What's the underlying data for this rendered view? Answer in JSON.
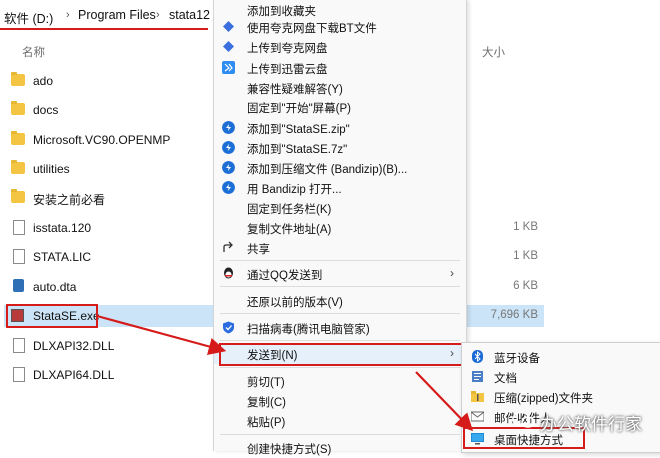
{
  "breadcrumb": {
    "drive": "软件 (D:)",
    "folder1": "Program Files",
    "folder2": "stata12",
    "separator": "›"
  },
  "columns": {
    "name": "名称",
    "size": "大小"
  },
  "files": [
    {
      "name": "ado",
      "size": "",
      "type": "folder"
    },
    {
      "name": "docs",
      "size": "",
      "type": "folder"
    },
    {
      "name": "Microsoft.VC90.OPENMP",
      "size": "",
      "type": "folder"
    },
    {
      "name": "utilities",
      "size": "",
      "type": "folder"
    },
    {
      "name": "安装之前必看",
      "size": "",
      "type": "folder"
    },
    {
      "name": "isstata.120",
      "size": "1 KB",
      "type": "file"
    },
    {
      "name": "STATA.LIC",
      "size": "1 KB",
      "type": "file"
    },
    {
      "name": "auto.dta",
      "size": "6 KB",
      "type": "dta"
    },
    {
      "name": "StataSE.exe",
      "size": "7,696 KB",
      "type": "exe"
    },
    {
      "name": "DLXAPI32.DLL",
      "size": "",
      "type": "file"
    },
    {
      "name": "DLXAPI64.DLL",
      "size": "",
      "type": "file"
    }
  ],
  "context_menu": {
    "items": [
      {
        "label": "添加到收藏夹",
        "icon": "none"
      },
      {
        "label": "使用夸克网盘下载BT文件",
        "icon": "quark-icon"
      },
      {
        "label": "上传到夸克网盘",
        "icon": "quark-icon"
      },
      {
        "label": "上传到迅雷云盘",
        "icon": "xunlei-icon"
      },
      {
        "label": "兼容性疑难解答(Y)",
        "icon": "none"
      },
      {
        "label": "固定到\"开始\"屏幕(P)",
        "icon": "none"
      },
      {
        "label": "添加到\"StataSE.zip\"",
        "icon": "bandizip-icon"
      },
      {
        "label": "添加到\"StataSE.7z\"",
        "icon": "bandizip-icon"
      },
      {
        "label": "添加到压缩文件 (Bandizip)(B)...",
        "icon": "bandizip-icon"
      },
      {
        "label": "用 Bandizip 打开...",
        "icon": "bandizip-icon"
      },
      {
        "label": "固定到任务栏(K)",
        "icon": "none"
      },
      {
        "label": "复制文件地址(A)",
        "icon": "none"
      },
      {
        "label": "共享",
        "icon": "share-icon"
      },
      {
        "label": "通过QQ发送到",
        "icon": "qq-icon"
      },
      {
        "label": "还原以前的版本(V)",
        "icon": "none"
      },
      {
        "label": "扫描病毒(腾讯电脑管家)",
        "icon": "shield-icon"
      },
      {
        "label": "发送到(N)",
        "icon": "none"
      },
      {
        "label": "剪切(T)",
        "icon": "none"
      },
      {
        "label": "复制(C)",
        "icon": "none"
      },
      {
        "label": "粘贴(P)",
        "icon": "none"
      },
      {
        "label": "创建快捷方式(S)",
        "icon": "none"
      }
    ],
    "arrow": "›"
  },
  "submenu": {
    "items": [
      {
        "label": "蓝牙设备",
        "icon": "bluetooth-icon"
      },
      {
        "label": "文档",
        "icon": "document-icon"
      },
      {
        "label": "压缩(zipped)文件夹",
        "icon": "zip-folder-icon"
      },
      {
        "label": "邮件收件人",
        "icon": "mail-icon"
      },
      {
        "label": "桌面快捷方式",
        "icon": "desktop-icon"
      }
    ]
  },
  "watermark": {
    "text": "办公软件行家"
  },
  "colors": {
    "accent_red": "#d61b1b",
    "selection": "#cce4f7",
    "menu_bg": "#f9f9f9"
  }
}
